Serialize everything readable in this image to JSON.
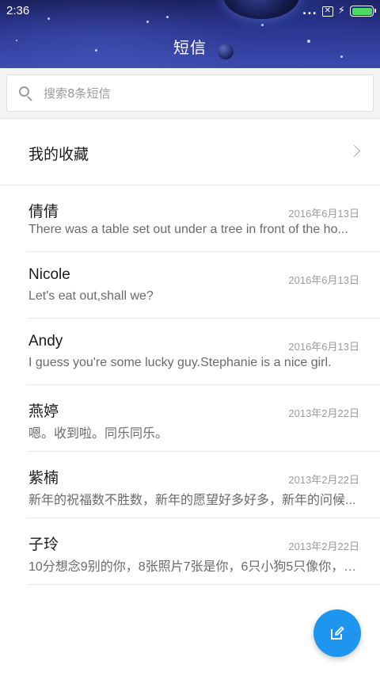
{
  "status_bar": {
    "time": "2:36",
    "more_indicator": "...",
    "sim_indicator": "✕",
    "charging_indicator": "⚡",
    "battery_level": 1.0,
    "battery_color": "#4cd964"
  },
  "header": {
    "title": "短信",
    "background_color": "#2c3690"
  },
  "search": {
    "placeholder": "搜索8条短信"
  },
  "favorites": {
    "label": "我的收藏"
  },
  "conversations": [
    {
      "name": "倩倩",
      "date": "2016年6月13日",
      "preview": "There was a table set out under a tree in front of the ho..."
    },
    {
      "name": "Nicole",
      "date": "2016年6月13日",
      "preview": "Let's eat out,shall we?"
    },
    {
      "name": "Andy",
      "date": "2016年6月13日",
      "preview": "I guess you're some lucky guy.Stephanie is a nice girl."
    },
    {
      "name": "燕婷",
      "date": "2013年2月22日",
      "preview": "嗯。收到啦。同乐同乐。"
    },
    {
      "name": "紫楠",
      "date": "2013年2月22日",
      "preview": "新年的祝福数不胜数，新年的愿望好多好多，新年的问候..."
    },
    {
      "name": "子玲",
      "date": "2013年2月22日",
      "preview": "10分想念9别的你，8张照片7张是你，6只小狗5只像你，4..."
    }
  ],
  "fab": {
    "icon": "compose-icon",
    "color": "#1e96f0"
  }
}
